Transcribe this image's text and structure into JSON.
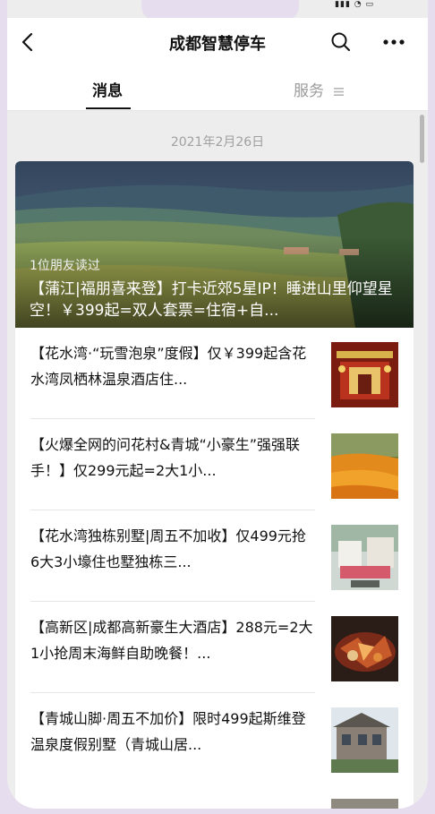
{
  "header": {
    "title": "成都智慧停车"
  },
  "tabs": [
    {
      "label": "消息"
    },
    {
      "label": "服务"
    }
  ],
  "feed": {
    "date": "2021年2月26日",
    "hero": {
      "readers": "1位朋友读过",
      "title": "【蒲江|福朋喜来登】打卡近郊5星IP！睡进山里仰望星空！￥399起=双人套票=住宿+自..."
    },
    "items": [
      {
        "title": "【花水湾·“玩雪泡泉”度假】仅￥399起含花水湾凤栖林温泉酒店住..."
      },
      {
        "title": "【火爆全网的问花村&青城“小豪生”强强联手！】仅299元起=2大1小..."
      },
      {
        "title": "【花水湾独栋别墅|周五不加收】仅499元抢6大3小壕住也墅独栋三..."
      },
      {
        "title": "【高新区|成都高新豪生大酒店】288元=2大1小抢周末海鲜自助晚餐！..."
      },
      {
        "title": "【青城山脚·周五不加价】限时499起斯维登温泉度假别墅（青城山居..."
      }
    ]
  },
  "icons": [
    "back-icon",
    "search-icon",
    "more-icon",
    "menu-icon"
  ]
}
